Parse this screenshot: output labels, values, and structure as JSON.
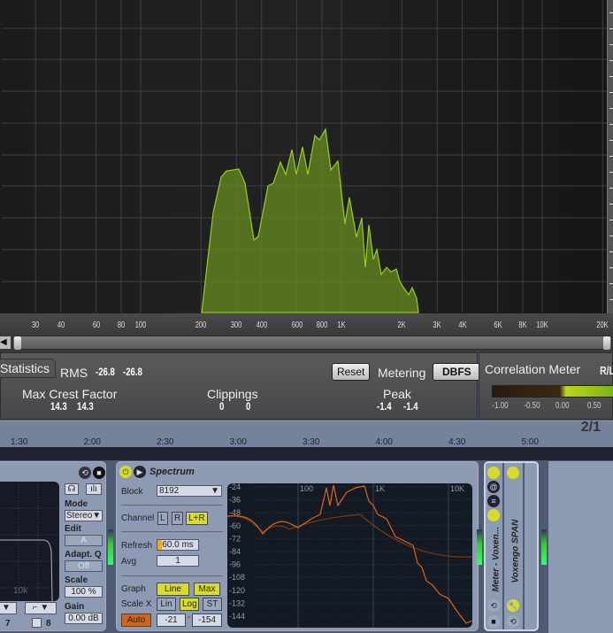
{
  "analyzer": {
    "freq_labels": [
      "30",
      "40",
      "60",
      "80",
      "100",
      "200",
      "300",
      "400",
      "600",
      "800",
      "1K",
      "2K",
      "3K",
      "4K",
      "6K",
      "8K",
      "10K",
      "20K"
    ],
    "stats_tab": "Statistics",
    "rms_label": "RMS",
    "rms_l": "-26.8",
    "rms_r": "-26.8",
    "reset": "Reset",
    "metering_label": "Metering",
    "metering_value": "DBFS",
    "crest_label": "Max Crest Factor",
    "crest_l": "14.3",
    "crest_r": "14.3",
    "clip_label": "Clippings",
    "clip_l": "0",
    "clip_r": "0",
    "peak_label": "Peak",
    "peak_l": "-1.4",
    "peak_r": "-1.4",
    "corr_tab": "Correlation Meter",
    "corr_mode": "R/L",
    "corr_ticks": [
      "-1.00",
      "-0.50",
      "0.00",
      "0.50"
    ]
  },
  "timeline": {
    "marks": [
      "1:30",
      "2:00",
      "2:30",
      "3:00",
      "3:30",
      "4:00",
      "4:30",
      "5:00"
    ],
    "signature": "2/1"
  },
  "eq": {
    "freq_label": "10k",
    "mode_label": "Mode",
    "mode_value": "Stereo",
    "edit_label": "Edit",
    "edit_value": "A",
    "adaptq_label": "Adapt. Q",
    "adaptq_value": "Off",
    "scale_label": "Scale",
    "scale_value": "100 %",
    "gain_label": "Gain",
    "gain_value": "0.00 dB",
    "band7": "7",
    "band8": "8"
  },
  "spectrum": {
    "title": "Spectrum",
    "block_label": "Block",
    "block_value": "8192",
    "channel_label": "Channel",
    "ch_l": "L",
    "ch_r": "R",
    "ch_lr": "L+R",
    "refresh_label": "Refresh",
    "refresh_value": "60.0 ms",
    "refresh_fraction": 0.1,
    "avg_label": "Avg",
    "avg_value": "1",
    "graph_label": "Graph",
    "graph_line": "Line",
    "graph_max": "Max",
    "scalex_label": "Scale X",
    "lin": "Lin",
    "log": "Log",
    "st": "ST",
    "auto": "Auto",
    "range_lo": "-21",
    "range_hi": "-154",
    "x_labels": [
      "100",
      "1K",
      "10K"
    ],
    "y_labels": [
      "-24",
      "-36",
      "-48",
      "-60",
      "-72",
      "-84",
      "-96",
      "-108",
      "-120",
      "-132",
      "-144"
    ]
  },
  "rack": {
    "meter_title": "Meter - Voxen...",
    "span_title": "Voxengo SPAN"
  }
}
